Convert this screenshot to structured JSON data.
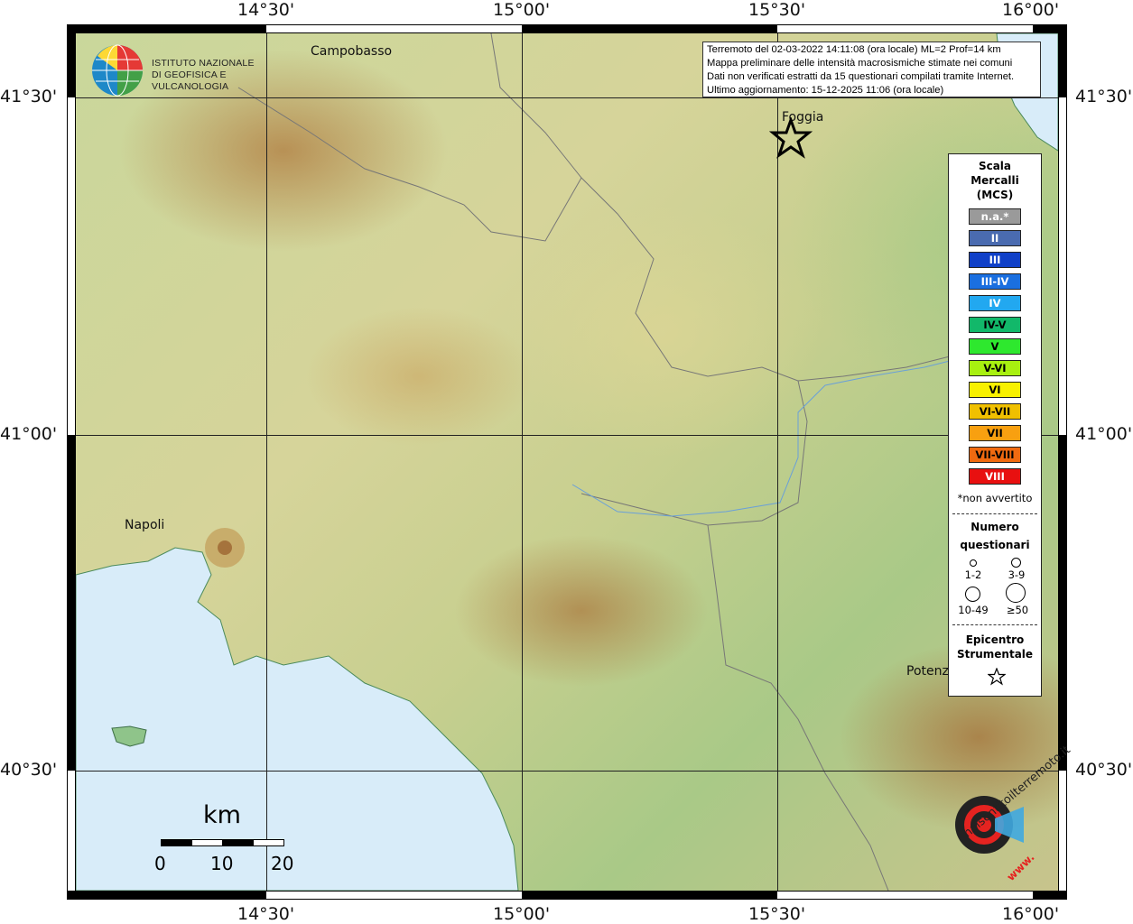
{
  "map": {
    "ticks_top": [
      "14°30'",
      "15°00'",
      "15°30'",
      "16°00'"
    ],
    "ticks_bottom": [
      "14°30'",
      "15°00'",
      "15°30'",
      "16°00'"
    ],
    "ticks_left": [
      "41°30'",
      "41°00'",
      "40°30'"
    ],
    "ticks_right": [
      "41°30'",
      "41°00'",
      "40°30'"
    ],
    "cities": {
      "campobasso": "Campobasso",
      "foggia": "Foggia",
      "napoli": "Napoli",
      "potenza": "Potenza"
    },
    "colors": {
      "sea": "#d8ecf9",
      "grid": "#222222"
    }
  },
  "logo": {
    "line1": "ISTITUTO NAZIONALE",
    "line2": "DI GEOFISICA E VULCANOLOGIA"
  },
  "info_box": {
    "line1": "Terremoto del 02-03-2022 14:11:08 (ora locale) ML=2 Prof=14 km",
    "line2": "Mappa preliminare delle intensità macrosismiche stimate nei comuni",
    "line3": "Dati non verificati estratti da 15 questionari compilati tramite Internet.",
    "line4": "Ultimo aggiornamento: 15-12-2025 11:06 (ora locale)"
  },
  "scale_bar": {
    "unit": "km",
    "labels": [
      "0",
      "10",
      "20"
    ]
  },
  "legend": {
    "title_lines": [
      "Scala",
      "Mercalli",
      "(MCS)"
    ],
    "classes": [
      {
        "label": "n.a.*",
        "color": "#9a9a9a",
        "text_color": "#ffffff"
      },
      {
        "label": "II",
        "color": "#4a6bb0",
        "text_color": "#ffffff"
      },
      {
        "label": "III",
        "color": "#1040c8",
        "text_color": "#ffffff"
      },
      {
        "label": "III-IV",
        "color": "#1a6fe0",
        "text_color": "#ffffff"
      },
      {
        "label": "IV",
        "color": "#22a8f0",
        "text_color": "#ffffff"
      },
      {
        "label": "IV-V",
        "color": "#12b86a",
        "text_color": "#000000"
      },
      {
        "label": "V",
        "color": "#2ee82e",
        "text_color": "#000000"
      },
      {
        "label": "V-VI",
        "color": "#a8f010",
        "text_color": "#000000"
      },
      {
        "label": "VI",
        "color": "#f8f000",
        "text_color": "#000000"
      },
      {
        "label": "VI-VII",
        "color": "#f0c000",
        "text_color": "#000000"
      },
      {
        "label": "VII",
        "color": "#f8a010",
        "text_color": "#000000"
      },
      {
        "label": "VII-VIII",
        "color": "#f06a10",
        "text_color": "#000000"
      },
      {
        "label": "VIII",
        "color": "#e81010",
        "text_color": "#ffffff"
      }
    ],
    "note": "*non avvertito",
    "questionnaires_title": [
      "Numero",
      "questionari"
    ],
    "questionnaire_sizes": [
      "1-2",
      "3-9",
      "10-49",
      "≥50"
    ],
    "epicenter_title": [
      "Epicentro",
      "Strumentale"
    ]
  },
  "watermark": {
    "text": "haisentitoilterremoto.it",
    "url": "www."
  }
}
